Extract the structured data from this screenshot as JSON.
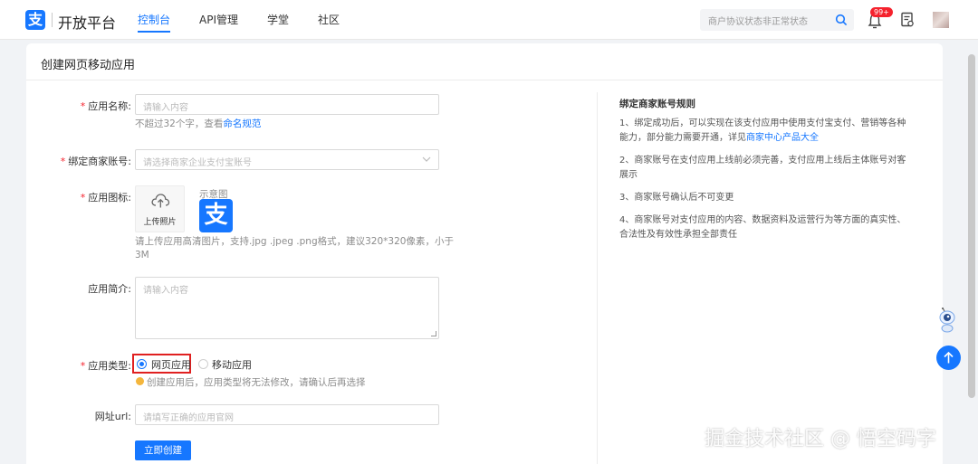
{
  "header": {
    "logo_glyph": "支",
    "brand": "开放平台",
    "nav": [
      "控制台",
      "API管理",
      "学堂",
      "社区"
    ],
    "active_nav": 0,
    "search_placeholder": "商户协议状态非正常状态",
    "badge": "99+"
  },
  "page": {
    "title": "创建网页移动应用"
  },
  "form": {
    "app_name": {
      "label": "应用名称:",
      "placeholder": "请输入内容",
      "help_prefix": "不超过32个字，查看",
      "help_link": "命名规范"
    },
    "merchant": {
      "label": "绑定商家账号:",
      "placeholder": "请选择商家企业支付宝账号"
    },
    "icon": {
      "label": "应用图标:",
      "upload_text": "上传照片",
      "sample_label": "示意图",
      "sample_glyph": "支",
      "help_line1": "请上传应用高清图片，支持.jpg .jpeg .png格式，建议320*320像素，小于",
      "help_line2": "3M"
    },
    "intro": {
      "label": "应用简介:",
      "placeholder": "请输入内容"
    },
    "type": {
      "label": "应用类型:",
      "options": [
        "网页应用",
        "移动应用"
      ],
      "selected": 0,
      "warning": "创建应用后，应用类型将无法修改，请确认后再选择"
    },
    "url": {
      "label": "网址url:",
      "placeholder": "请填写正确的应用官网"
    },
    "submit_label": "立即创建"
  },
  "rules": {
    "title": "绑定商家账号规则",
    "items": [
      {
        "line1": "1、绑定成功后，可以实现在该支付应用中使用支付宝支付、营销等各种",
        "line2_prefix": "能力，部分能力需要开通，详见",
        "line2_link": "商家中心产品大全"
      },
      {
        "line1": "2、商家账号在支付应用上线前必须完善，支付应用上线后主体账号对客",
        "line2": "展示"
      },
      {
        "line1": "3、商家账号确认后不可变更"
      },
      {
        "line1": "4、商家账号对支付应用的内容、数据资料及运营行为等方面的真实性、",
        "line2": "合法性及有效性承担全部责任"
      }
    ]
  },
  "watermark": "掘金技术社区 @ 悟空码字",
  "colors": {
    "primary": "#1677ff",
    "required": "#f5222d",
    "highlight_border": "#e02020",
    "warning": "#f4b63c"
  }
}
